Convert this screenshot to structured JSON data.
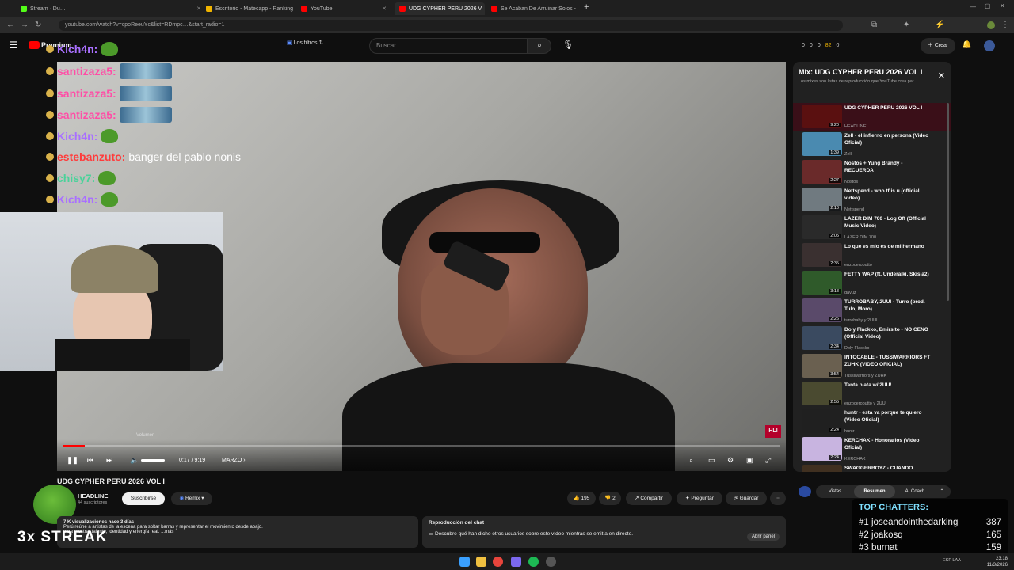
{
  "browser": {
    "tabs": [
      {
        "label": "Stream · Du…",
        "color": "#53fc18",
        "active": false
      },
      {
        "label": "Escritorio - Matecapp - Ranking",
        "color": "#f0b400",
        "active": false
      },
      {
        "label": "YouTube",
        "color": "#ff0000",
        "active": false
      },
      {
        "label": "UDG CYPHER PERU 2026 V",
        "color": "#ff0000",
        "active": true
      },
      {
        "label": "Se Acaban De Arruinar Solos -",
        "color": "#ff0000",
        "active": false
      }
    ],
    "new_tab": "+",
    "url": "youtube.com/watch?v=cpoReeuYc&list=RDmpc…&start_radio=1"
  },
  "youtube": {
    "logo": "Premium",
    "filters_label": "Los filtros",
    "search_placeholder": "Buscar",
    "create_label": "Crear",
    "stats": [
      "0",
      "0",
      "0",
      "82",
      "0"
    ]
  },
  "chat_overlay": [
    {
      "user": "Kich4n:",
      "color": "#a970ff",
      "text": "",
      "emote": "pepe"
    },
    {
      "user": "santizaza5:",
      "color": "#ff4da6",
      "text": "",
      "emote": "cars"
    },
    {
      "user": "santizaza5:",
      "color": "#ff4da6",
      "text": "",
      "emote": "cars"
    },
    {
      "user": "santizaza5:",
      "color": "#ff4da6",
      "text": "",
      "emote": "cars"
    },
    {
      "user": "Kich4n:",
      "color": "#a970ff",
      "text": "",
      "emote": "pepe"
    },
    {
      "user": "estebanzuto:",
      "color": "#ff3b3b",
      "text": "banger del pablo nonis",
      "emote": ""
    },
    {
      "user": "chisy7:",
      "color": "#4ad29a",
      "text": "",
      "emote": "pepe"
    },
    {
      "user": "Kich4n:",
      "color": "#a970ff",
      "text": "",
      "emote": "pepe"
    }
  ],
  "player": {
    "time": "0:17 / 9:19",
    "chapter": "MARZO",
    "volume_tooltip": "Volumen",
    "progress": 0.03,
    "badge": "HLI"
  },
  "video": {
    "title": "UDG CYPHER PERU 2026 VOL I",
    "channel": "HEADLINE",
    "subscribers": "44 suscriptores",
    "subscribe_label": "Suscribirse",
    "remix_label": "Remix",
    "likes": "195",
    "dislikes": "2",
    "share": "Compartir",
    "ask": "Preguntar",
    "save": "Guardar",
    "views": "7 K visualizaciones  hace 3 días",
    "desc_line1": "Perú reúne a artistas de la escena para soltar barras y representar el movimiento desde abajo.",
    "desc_line2": "para mostrar talento, identidad y energía real.  ...más"
  },
  "chat_replay": {
    "title": "Reproducción del chat",
    "text": "Descubre qué han dicho otros usuarios sobre este vídeo mientras se emitía en directo.",
    "button": "Abrir panel"
  },
  "side_tabs": [
    "Vistas",
    "Resumen",
    "AI Coach"
  ],
  "playlist": {
    "title": "Mix: UDG CYPHER PERU 2026 VOL I",
    "subtitle": "Los mixes son listas de reproducción que YouTube crea par…",
    "items": [
      {
        "title": "UDG CYPHER PERU 2026 VOL I",
        "channel": "HEADLINE",
        "duration": "9:20",
        "color": "#5a1010"
      },
      {
        "title": "Zell - el infierno en persona (Video Oficial)",
        "channel": "Zell",
        "duration": "1:39",
        "color": "#4a8ab0"
      },
      {
        "title": "Nostos + Yung Brandy - RECUERDA",
        "channel": "Nostos",
        "duration": "2:27",
        "color": "#6a2a2a"
      },
      {
        "title": "Nettspend - who tf is u (official video)",
        "channel": "Nettspend",
        "duration": "2:10",
        "color": "#707a80"
      },
      {
        "title": "LAZER DIM 700 - Log Off (Official Music Video)",
        "channel": "LAZER DIM 700",
        "duration": "2:05",
        "color": "#2a2a2a"
      },
      {
        "title": "Lo que es mio es de mi hermano",
        "channel": "enzocerobutto",
        "duration": "2:35",
        "color": "#3a3030"
      },
      {
        "title": "FETTY WAP (ft. Underaiki, Skisia2)",
        "channel": "davuz",
        "duration": "3:18",
        "color": "#2f5a2a"
      },
      {
        "title": "TURROBABY, 2UUI - Turro (prod. Tulo, Moro)",
        "channel": "turrobaby y 2UUI",
        "duration": "2:26",
        "color": "#5a4a6a"
      },
      {
        "title": "Doly Flackko, Emirsito - NO CENO (Official Video)",
        "channel": "Doly Flackko",
        "duration": "2:34",
        "color": "#3a4a60"
      },
      {
        "title": "INTOCABLE - TUSSIWARRIORS FT ZUHK (VIDEO OFICIAL)",
        "channel": "Tussiwarriors y ZUHK",
        "duration": "3:54",
        "color": "#6a6050"
      },
      {
        "title": "Tanta plata w/ 2UU!",
        "channel": "enzocerobutto y 2UUI",
        "duration": "2:55",
        "color": "#4a4a30"
      },
      {
        "title": "huntr - esta va porque te quiero (Video Oficial)",
        "channel": "huntr",
        "duration": "2:24",
        "color": "#202020"
      },
      {
        "title": "KERCHAK - Honorarios (Video Oficial)",
        "channel": "KERCHAK",
        "duration": "2:24",
        "color": "#c8b4e0"
      },
      {
        "title": "SWAGGERBOYZ - CUANDO QUIERO (Video Oficial)",
        "channel": "",
        "duration": "",
        "color": "#403020"
      }
    ]
  },
  "top_chatters": {
    "title": "TOP CHATTERS:",
    "rows": [
      {
        "rank": "#1",
        "name": "joseandointhedarking",
        "count": "387"
      },
      {
        "rank": "#2",
        "name": "joakosq",
        "count": "165"
      },
      {
        "rank": "#3",
        "name": "burnat",
        "count": "159"
      }
    ]
  },
  "streak": "3x STREAK",
  "taskbar": {
    "time": "23:18",
    "date": "11/3/2026",
    "lang": "ESP LAA"
  }
}
